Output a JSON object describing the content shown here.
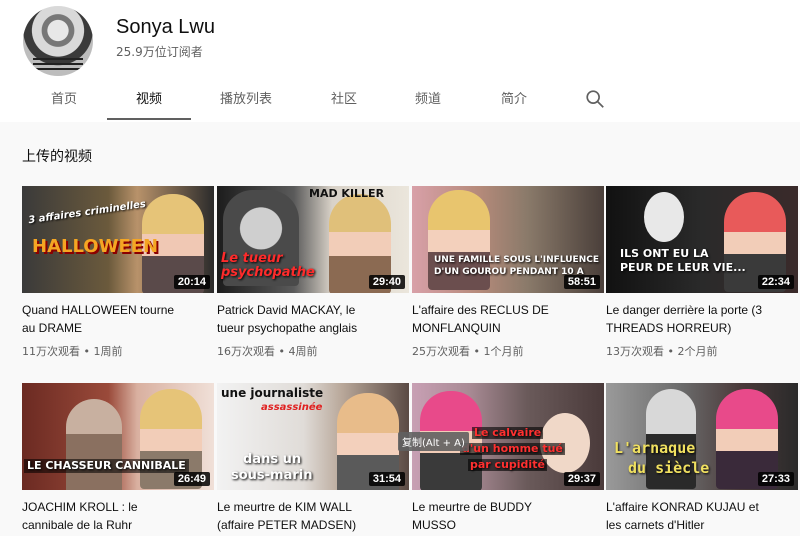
{
  "channel": {
    "name": "Sonya Lwu",
    "subscribers": "25.9万位订阅者"
  },
  "tabs": [
    {
      "label": "首页"
    },
    {
      "label": "视频"
    },
    {
      "label": "播放列表"
    },
    {
      "label": "社区"
    },
    {
      "label": "频道"
    },
    {
      "label": "简介"
    }
  ],
  "section_title": "上传的视频",
  "tooltip": "复制(Alt + A)",
  "videos": [
    {
      "title_1": "Quand HALLOWEEN tourne",
      "title_2": "au DRAME",
      "meta": "11万次观看 • 1周前",
      "duration": "20:14",
      "caption_1": "3 affaires criminelles",
      "caption_2": "HALLOWEEN"
    },
    {
      "title_1": "Patrick David MACKAY, le",
      "title_2": "tueur psychopathe anglais",
      "meta": "16万次观看 • 4周前",
      "duration": "29:40",
      "caption_1": "MAD KILLER",
      "caption_2": "Le tueur psychopathe"
    },
    {
      "title_1": "L'affaire des RECLUS DE",
      "title_2": "MONFLANQUIN",
      "meta": "25万次观看 • 1个月前",
      "duration": "58:51",
      "caption_1": "UNE FAMILLE SOUS L'INFLUENCE",
      "caption_2": "D'UN GOUROU PENDANT 10 A"
    },
    {
      "title_1": "Le danger derrière la porte (3",
      "title_2": "THREADS HORREUR)",
      "meta": "13万次观看 • 2个月前",
      "duration": "22:34",
      "caption_1": "ILS ONT EU LA",
      "caption_2": "PEUR DE LEUR VIE..."
    },
    {
      "title_1": "JOACHIM KROLL : le",
      "title_2": "cannibale de la Ruhr",
      "meta": "",
      "duration": "26:49",
      "caption_1": "LE CHASSEUR CANNIBALE",
      "caption_2": ""
    },
    {
      "title_1": "Le meurtre de KIM WALL",
      "title_2": "(affaire PETER MADSEN)",
      "meta": "",
      "duration": "31:54",
      "caption_1": "une journaliste",
      "caption_2": "assassinée",
      "caption_3": "dans un",
      "caption_4": "sous-marin"
    },
    {
      "title_1": "Le meurtre de BUDDY",
      "title_2": "MUSSO",
      "meta": "",
      "duration": "29:37",
      "caption_1": "Le calvaire",
      "caption_2": "d'un homme tué",
      "caption_3": "par cupidité"
    },
    {
      "title_1": "L'affaire KONRAD KUJAU et",
      "title_2": "les carnets d'Hitler",
      "meta": "",
      "duration": "27:33",
      "caption_1": "L'arnaque",
      "caption_2": "du siècle"
    }
  ]
}
